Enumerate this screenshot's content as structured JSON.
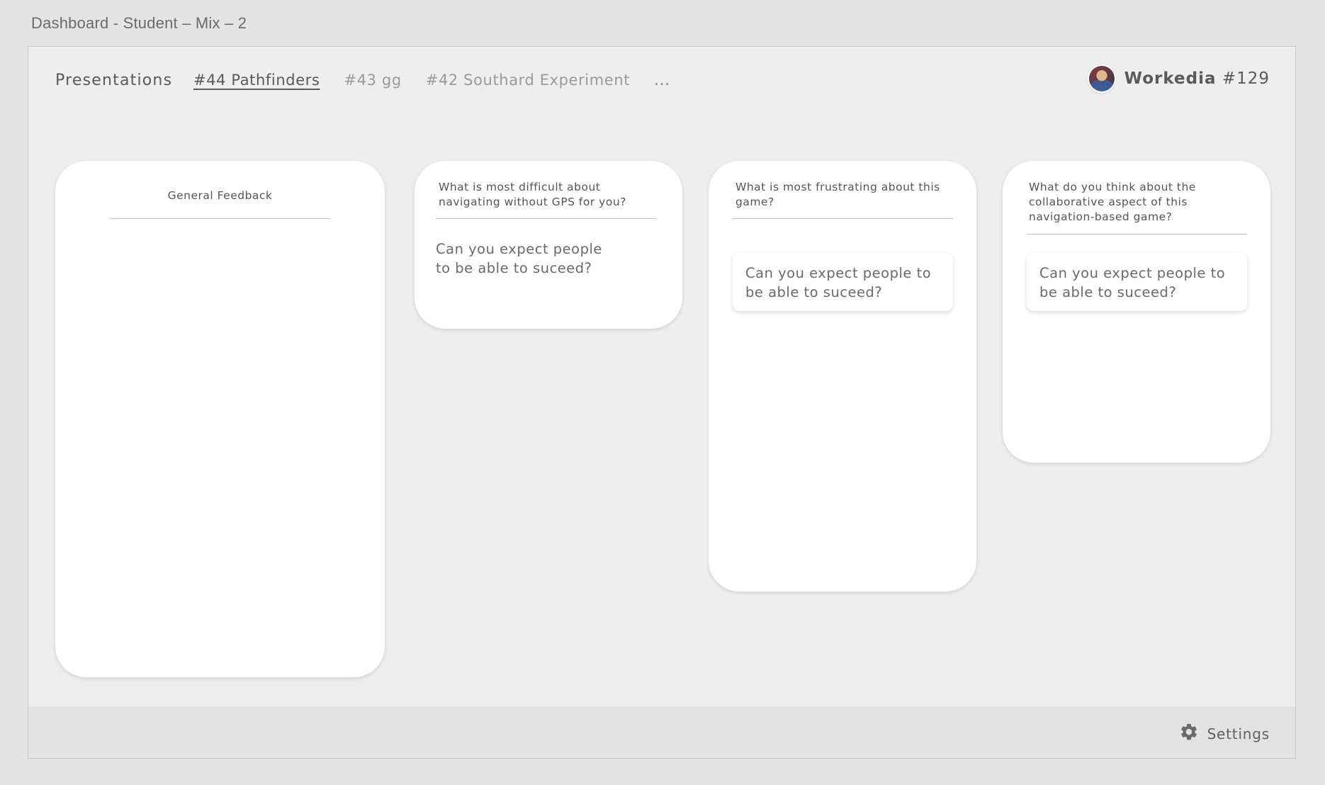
{
  "window": {
    "title": "Dashboard - Student – Mix – 2"
  },
  "header": {
    "brand": "Presentations",
    "tabs": [
      {
        "label": "#44 Pathfinders",
        "active": true
      },
      {
        "label": "#43 gg",
        "active": false
      },
      {
        "label": "#42 Southard Experiment",
        "active": false
      },
      {
        "label": "...",
        "active": false
      }
    ],
    "user": {
      "name": "Workedia",
      "number": "#129"
    }
  },
  "columns": [
    {
      "title": "General Feedback",
      "notes": []
    },
    {
      "title": "What is most difficult about navigating without GPS for you?",
      "notes": [
        {
          "text": "Can you expect people to be able to suceed?"
        }
      ]
    },
    {
      "title": "What is most frustrating about this game?",
      "notes": [
        {
          "text": "Can you expect people to be able to suceed?"
        }
      ]
    },
    {
      "title": "What do you think about the collaborative aspect of this navigation-based game?",
      "notes": [
        {
          "text": "Can you expect people to be able to suceed?"
        }
      ]
    }
  ],
  "footer": {
    "settings_label": "Settings",
    "settings_icon": "gear-icon"
  },
  "colors": {
    "page_background": "#e4e4e4",
    "frame_background": "#eeeeee",
    "card_background": "#ffffff",
    "footer_background": "#e2e2e2",
    "text_primary": "#5a5a5a",
    "text_muted": "#9a9a9a"
  }
}
